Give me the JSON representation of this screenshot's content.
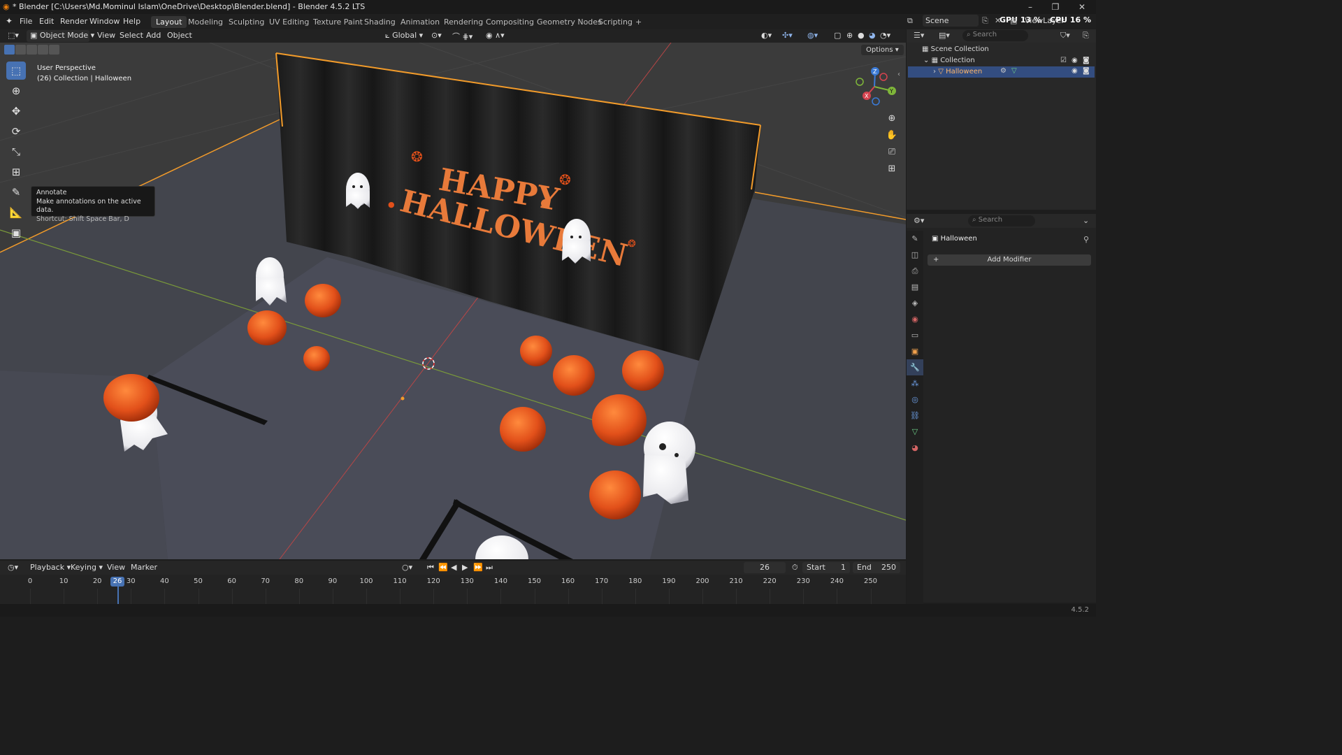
{
  "window": {
    "title": "* Blender [C:\\Users\\Md.Mominul Islam\\OneDrive\\Desktop\\Blender.blend] - Blender 4.5.2 LTS",
    "minimize": "–",
    "maximize": "❐",
    "close": "✕"
  },
  "menubar": {
    "items": [
      "File",
      "Edit",
      "Render",
      "Window",
      "Help"
    ],
    "workspaces": [
      "Layout",
      "Modeling",
      "Sculpting",
      "UV Editing",
      "Texture Paint",
      "Shading",
      "Animation",
      "Rendering",
      "Compositing",
      "Geometry Nodes",
      "Scripting"
    ],
    "add_tab": "+",
    "scene_label": "Scene",
    "viewlayer_label": "ViewLayer",
    "gpu": "GPU 13 %",
    "cpu": "CPU 16 %"
  },
  "viewport_header": {
    "mode": "Object Mode",
    "menus": [
      "View",
      "Select",
      "Add",
      "Object"
    ],
    "orientation": "Global",
    "options": "Options"
  },
  "viewport": {
    "perspective": "User Perspective",
    "collection_info": "(26) Collection | Halloween",
    "banner_line1": "HAPPY",
    "banner_line2": "HALLOWEEN",
    "gizmo_x": "X",
    "gizmo_y": "Y",
    "gizmo_z": "Z"
  },
  "tooltip": {
    "title": "Annotate",
    "description": "Make annotations on the active data.",
    "shortcut": "Shortcut: Shift Space Bar, D"
  },
  "outliner": {
    "search_placeholder": "Search",
    "scene_collection": "Scene Collection",
    "collection": "Collection",
    "object": "Halloween"
  },
  "properties": {
    "search_placeholder": "Search",
    "object_name": "Halloween",
    "add_modifier": "Add Modifier"
  },
  "timeline": {
    "menus": [
      "Playback",
      "Keying",
      "View",
      "Marker"
    ],
    "current_frame": "26",
    "start_label": "Start",
    "start_value": "1",
    "end_label": "End",
    "end_value": "250",
    "ticks": [
      "0",
      "10",
      "20",
      "30",
      "40",
      "50",
      "60",
      "70",
      "80",
      "90",
      "100",
      "110",
      "120",
      "130",
      "140",
      "150",
      "160",
      "170",
      "180",
      "190",
      "200",
      "210",
      "220",
      "230",
      "240",
      "250"
    ],
    "playhead": "26"
  },
  "statusbar": {
    "version": "4.5.2"
  },
  "colors": {
    "accent": "#4772b3",
    "pumpkin": "#e2501a",
    "selection_outline": "#f29b2a",
    "text_orange": "#e87a3a"
  }
}
